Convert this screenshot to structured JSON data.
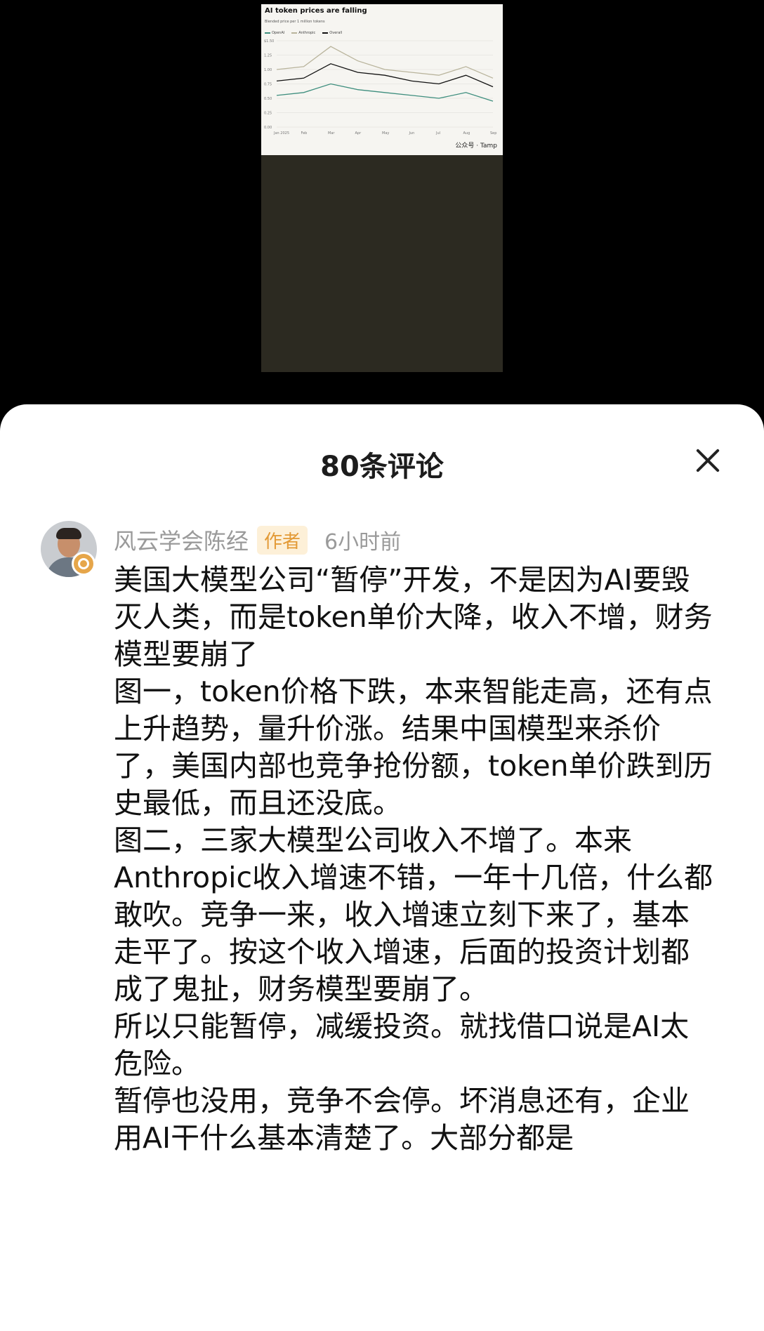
{
  "media": {
    "chart_title": "AI token prices are falling",
    "chart_subtitle": "Blended price per 1 million tokens",
    "legend": [
      "OpenAI",
      "Anthropic",
      "Overall"
    ],
    "ylabels": [
      "$1.50",
      "1.25",
      "1.00",
      "0.75",
      "0.50",
      "0.25",
      "0.00"
    ],
    "xlabels": [
      "Jan 2025",
      "Feb",
      "Mar",
      "Apr",
      "May",
      "Jun",
      "Jul",
      "Aug",
      "Sep"
    ],
    "watermark": "公众号 · Tamp"
  },
  "chart_data": {
    "type": "line",
    "title": "AI token prices are falling",
    "subtitle": "Blended price per 1 million tokens",
    "x": [
      "Jan",
      "Feb",
      "Mar",
      "Apr",
      "May",
      "Jun",
      "Jul",
      "Aug",
      "Sep"
    ],
    "ylim": [
      0,
      1.5
    ],
    "series": [
      {
        "name": "OpenAI",
        "values": [
          0.55,
          0.6,
          0.75,
          0.65,
          0.6,
          0.55,
          0.5,
          0.6,
          0.45
        ]
      },
      {
        "name": "Anthropic",
        "values": [
          1.0,
          1.05,
          1.4,
          1.15,
          1.0,
          0.95,
          0.9,
          1.05,
          0.85
        ]
      },
      {
        "name": "Overall",
        "values": [
          0.8,
          0.85,
          1.1,
          0.95,
          0.9,
          0.8,
          0.75,
          0.9,
          0.7
        ]
      }
    ],
    "colors": {
      "OpenAI": "#3e8e7e",
      "Anthropic": "#b9b49c",
      "Overall": "#111111"
    }
  },
  "sheet": {
    "title": "80条评论",
    "close_icon": "close-icon"
  },
  "comment": {
    "username": "风云学会陈经",
    "author_tag": "作者",
    "time": "6小时前",
    "paragraphs": [
      "美国大模型公司“暂停”开发，不是因为AI要毁灭人类，而是token单价大降，收入不增，财务模型要崩了",
      "图一，token价格下跌，本来智能走高，还有点上升趋势，量升价涨。结果中国模型来杀价了，美国内部也竞争抢份额，token单价跌到历史最低，而且还没底。",
      "图二，三家大模型公司收入不增了。本来Anthropic收入增速不错，一年十几倍，什么都敢吹。竞争一来，收入增速立刻下来了，基本走平了。按这个收入增速，后面的投资计划都成了鬼扯，财务模型要崩了。",
      "所以只能暂停，减缓投资。就找借口说是AI太危险。",
      "暂停也没用，竞争不会停。坏消息还有，企业用AI干什么基本清楚了。大部分都是"
    ]
  }
}
